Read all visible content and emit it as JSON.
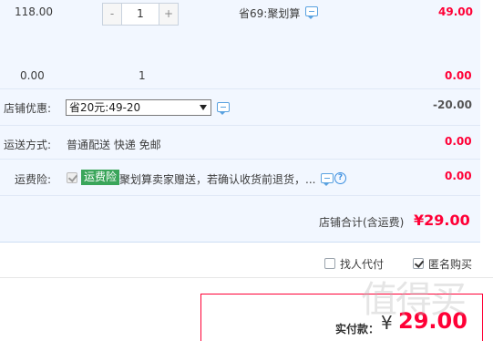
{
  "item": {
    "unit_price": "118.00",
    "quantity": "1",
    "minus_label": "-",
    "plus_label": "+",
    "promo": "省69:聚划算",
    "subtotal": "49.00"
  },
  "package_row": {
    "price": "0.00",
    "quantity": "1",
    "subtotal": "0.00"
  },
  "shop_discount": {
    "label": "店铺优惠:",
    "selected": "省20元:49-20",
    "amount": "-20.00"
  },
  "shipping": {
    "label": "运送方式:",
    "text": "普通配送 快递 免邮",
    "amount": "0.00"
  },
  "insurance": {
    "label": "运费险:",
    "badge": "运费险",
    "text": "聚划算卖家赠送，若确认收货前退货，...",
    "amount": "0.00"
  },
  "shop_total": {
    "label": "店铺合计(含运费)",
    "amount": "¥29.00"
  },
  "options": {
    "proxy_pay": "找人代付",
    "anonymous": "匿名购买"
  },
  "payment": {
    "label": "实付款：",
    "currency": "¥",
    "amount": "29.00"
  },
  "watermark": "值得买",
  "colors": {
    "accent_red": "#ff0036",
    "panel_bg": "#f2f7ff",
    "badge_green": "#3aa55a",
    "link_blue": "#3b8fe0"
  }
}
